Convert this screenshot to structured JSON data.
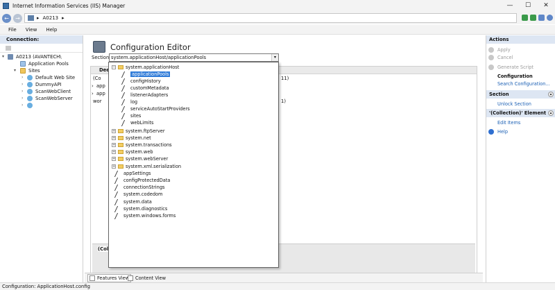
{
  "window": {
    "title": "Internet Information Services (IIS) Manager",
    "minimize": "—",
    "maximize": "☐",
    "close": "✕"
  },
  "address": {
    "back": "←",
    "forward": "→",
    "path_server": "A0213",
    "separator": "▸"
  },
  "menu": {
    "items": [
      "File",
      "View",
      "Help"
    ]
  },
  "connections": {
    "header": "Connection:",
    "tree": {
      "server": "A0213 (AVANTECH\\",
      "app_pools": "Application Pools",
      "sites": "Sites",
      "site_items": [
        "Default Web Site",
        "DummyAPI",
        "ScanWebClient",
        "ScanWebServer"
      ]
    }
  },
  "editor": {
    "title": "Configuration Editor",
    "section_label": "Section:",
    "section_value": "system.applicationHost/applicationPools",
    "grid_header": "Dee",
    "rows": [
      {
        "k": "(Co",
        "v": "11)"
      },
      {
        "k": "app",
        "v": ""
      },
      {
        "k": "app",
        "v": ""
      },
      {
        "k": "wor",
        "v": "1)"
      }
    ],
    "footer_label": "(Collec"
  },
  "dropdown": {
    "root": "system.applicationHost",
    "children": [
      "applicationPools",
      "configHistory",
      "customMetadata",
      "listenerAdapters",
      "log",
      "serviceAutoStartProviders",
      "sites",
      "webLimits"
    ],
    "folders": [
      "system.ftpServer",
      "system.net",
      "system.transactions",
      "system.web",
      "system.webServer",
      "system.xml.serialization"
    ],
    "pages": [
      "appSettings",
      "configProtectedData",
      "connectionStrings",
      "system.codedom",
      "system.data",
      "system.diagnostics",
      "system.windows.forms"
    ]
  },
  "actions": {
    "header": "Actions",
    "apply": "Apply",
    "cancel": "Cancel",
    "generate": "Generate Script",
    "config_heading": "Configuration",
    "search_config": "Search Configuration...",
    "section_header": "Section",
    "unlock": "Unlock Section",
    "collection_header": "'(Collection)' Element",
    "edit_items": "Edit Items",
    "help": "Help"
  },
  "tabs": {
    "features": "Features View",
    "content": "Content View"
  },
  "status": "Configuration: ApplicationHost.config"
}
